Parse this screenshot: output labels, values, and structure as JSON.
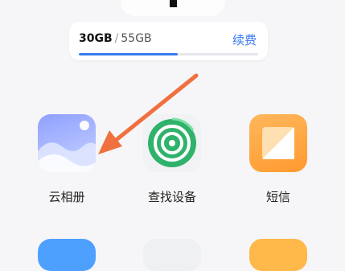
{
  "storage": {
    "used": "30GB",
    "separator": "/",
    "total": "55GB",
    "used_fraction": 0.55,
    "renew_label": "续费",
    "accent": "#3a7cf0"
  },
  "apps": [
    {
      "label": "云相册",
      "icon": "gallery-icon"
    },
    {
      "label": "查找设备",
      "icon": "find-device-icon"
    },
    {
      "label": "短信",
      "icon": "sms-icon"
    }
  ],
  "colors": {
    "arrow": "#f07040",
    "find_green": "#2fb26b",
    "sms_orange": "#ffa03a"
  }
}
